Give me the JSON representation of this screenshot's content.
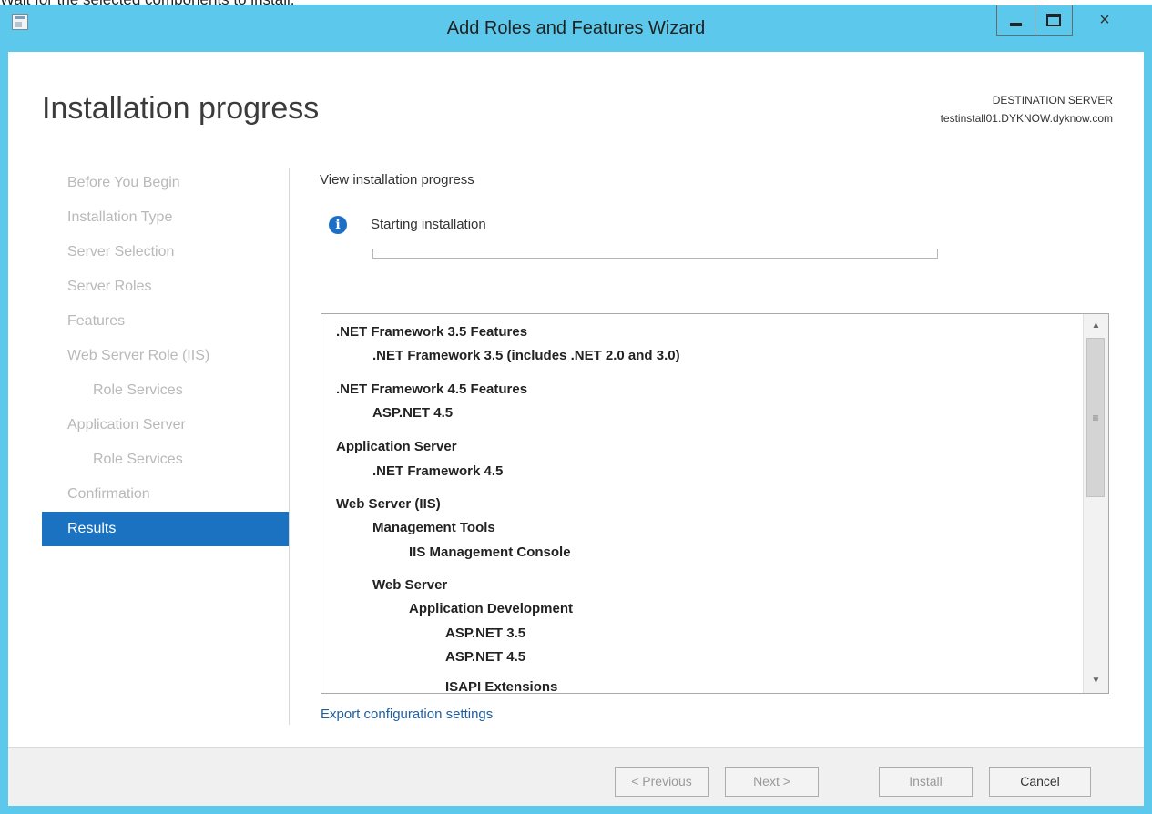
{
  "caption": "Wait for the selected components to install.",
  "window": {
    "title": "Add Roles and Features Wizard",
    "close_glyph": "×"
  },
  "header": {
    "page_title": "Installation progress",
    "destination_label": "DESTINATION SERVER",
    "destination_value": "testinstall01.DYKNOW.dyknow.com"
  },
  "nav": {
    "items": [
      {
        "label": "Before You Begin"
      },
      {
        "label": "Installation Type"
      },
      {
        "label": "Server Selection"
      },
      {
        "label": "Server Roles"
      },
      {
        "label": "Features"
      },
      {
        "label": "Web Server Role (IIS)"
      },
      {
        "label": "Role Services"
      },
      {
        "label": "Application Server"
      },
      {
        "label": "Role Services"
      },
      {
        "label": "Confirmation"
      },
      {
        "label": "Results"
      }
    ]
  },
  "main": {
    "section_title": "View installation progress",
    "status_text": "Starting installation",
    "progress_percent": 0,
    "features": [
      ".NET Framework 3.5 Features",
      ".NET Framework 3.5 (includes .NET 2.0 and 3.0)",
      ".NET Framework 4.5 Features",
      "ASP.NET 4.5",
      "Application Server",
      ".NET Framework 4.5",
      "Web Server (IIS)",
      "Management Tools",
      "IIS Management Console",
      "Web Server",
      "Application Development",
      "ASP.NET 3.5",
      "ASP.NET 4.5",
      "ISAPI Extensions"
    ],
    "export_link": "Export configuration settings"
  },
  "footer": {
    "previous_label": "< Previous",
    "next_label": "Next >",
    "install_label": "Install",
    "cancel_label": "Cancel"
  },
  "colors": {
    "window_border": "#5bc8ec",
    "nav_active": "#1b72c0",
    "info_icon": "#1c6fc4",
    "link": "#1f5f9e"
  }
}
